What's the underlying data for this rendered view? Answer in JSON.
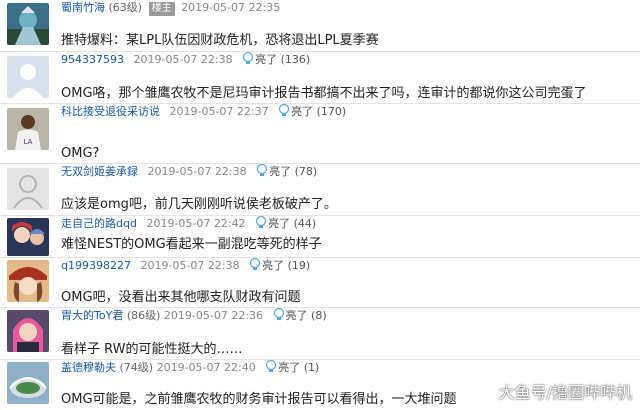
{
  "posts": [
    {
      "user": "蜀南竹海",
      "level": "(63级)",
      "tag": "楼主",
      "time": "2019-05-07 22:35",
      "likes": "",
      "text": "推特爆料：某LPL队伍因财政危机，恐将退出LPL夏季赛",
      "avatar_icon": "dota-hero-avatar-icon"
    },
    {
      "user": "954337593",
      "level": "",
      "tag": "",
      "time": "2019-05-07 22:38",
      "likes": "(136)",
      "text": "OMG咯，那个雏鹰农牧不是尼玛审计报告书都搞不出来了吗，连审计的都说你这公司完蛋了",
      "avatar_icon": "default-person-avatar-icon"
    },
    {
      "user": "科比接受退役采访说",
      "level": "",
      "tag": "",
      "time": "2019-05-07 22:37",
      "likes": "(170)",
      "text": "OMG?",
      "avatar_icon": "basketball-player-avatar-icon"
    },
    {
      "user": "无双剑姬姜承録",
      "level": "",
      "tag": "",
      "time": "2019-05-07 22:38",
      "likes": "(78)",
      "text": "应该是omg吧，前几天刚刚听说侯老板破产了。",
      "avatar_icon": "default-person-avatar-icon"
    },
    {
      "user": "走自己的路dqd",
      "level": "",
      "tag": "",
      "time": "2019-05-07 22:42",
      "likes": "(44)",
      "text": "难怪NEST的OMG看起来一副混吃等死的样子",
      "avatar_icon": "anime-character-avatar-icon"
    },
    {
      "user": "q199398227",
      "level": "",
      "tag": "",
      "time": "2019-05-07 22:38",
      "likes": "(19)",
      "text": "OMG吧，没看出来其他哪支队财政有问题",
      "avatar_icon": "red-hat-girl-avatar-icon"
    },
    {
      "user": "胃大的ToY君",
      "level": "(86级)",
      "tag": "",
      "time": "2019-05-07 22:36",
      "likes": "(8)",
      "text": "看样子 RW的可能性挺大的……",
      "avatar_icon": "pink-hair-champion-avatar-icon"
    },
    {
      "user": "盖德穆勒夫",
      "level": "(74级)",
      "tag": "",
      "time": "2019-05-07 22:40",
      "likes": "(1)",
      "text": "OMG可能是，之前雏鹰农牧的财务审计报告可以看得出，一大堆问题",
      "avatar_icon": "stadium-avatar-icon"
    }
  ],
  "like_label": "亮了",
  "watermark": "大鱼号/撸圈哔哔机",
  "colors": {
    "username": "#1a5aa8",
    "meta": "#888888",
    "tag_bg": "#9a9a9a",
    "bulb": "#5aa6d8"
  }
}
